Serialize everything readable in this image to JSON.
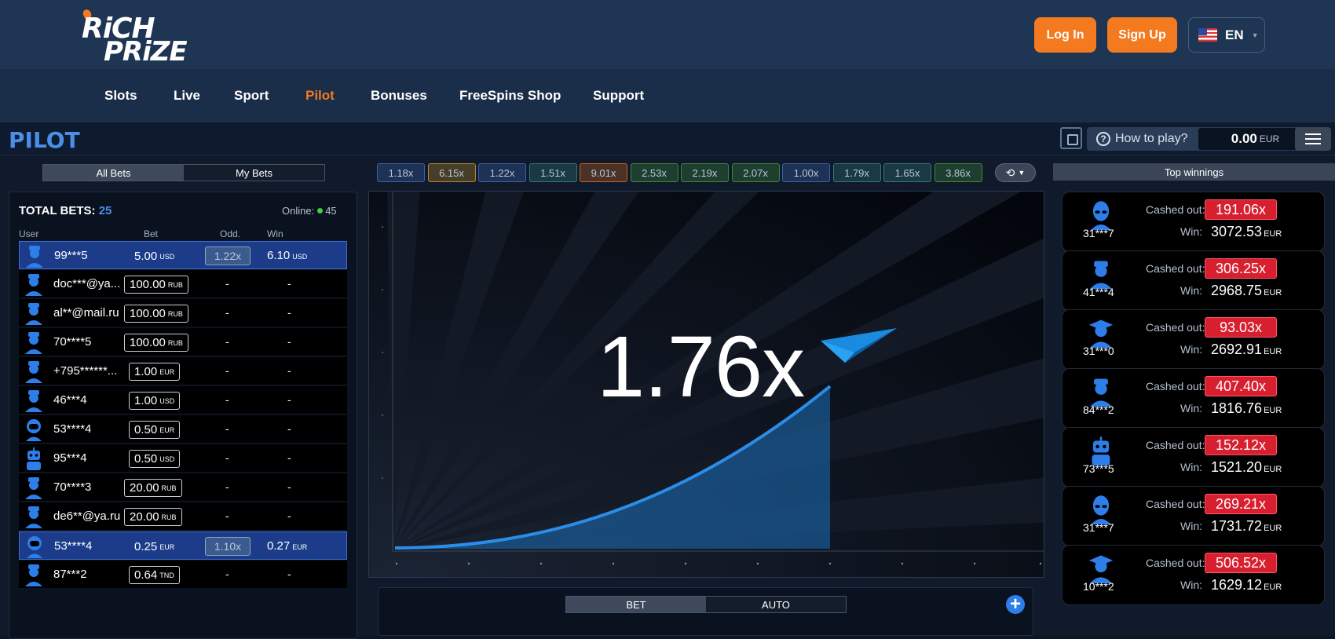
{
  "header": {
    "logo": {
      "line1": "RiCH",
      "line2": "PRiZE"
    },
    "login_label": "Log In",
    "signup_label": "Sign Up",
    "language": "EN",
    "colors": {
      "header_bg": "#1f3554",
      "accent": "#f47a1f",
      "active_nav": "#f47a1f"
    }
  },
  "nav": {
    "items": [
      {
        "label": "Slots",
        "active": false
      },
      {
        "label": "Live",
        "active": false
      },
      {
        "label": "Sport",
        "active": false
      },
      {
        "label": "Pilot",
        "active": true
      },
      {
        "label": "Bonuses",
        "active": false
      },
      {
        "label": "FreeSpins Shop",
        "active": false
      },
      {
        "label": "Support",
        "active": false
      }
    ]
  },
  "gamebar": {
    "title": "PILOT",
    "how_to_play": "How to play?",
    "balance_value": "0.00",
    "balance_currency": "EUR"
  },
  "bets": {
    "tabs": [
      {
        "label": "All Bets",
        "active": true
      },
      {
        "label": "My Bets",
        "active": false
      }
    ],
    "total_label": "TOTAL BETS",
    "total_value": "25",
    "online_label": "Online:",
    "online_value": "45",
    "columns": [
      "User",
      "Bet",
      "Odd.",
      "Win"
    ],
    "rows": [
      {
        "user": "99***5",
        "bet": "5.00",
        "currency": "USD",
        "odd": "1.22x",
        "win": "6.10",
        "win_currency": "USD",
        "won": true,
        "avatar": "user-icon"
      },
      {
        "user": "doc***@ya...",
        "bet": "100.00",
        "currency": "RUB",
        "odd": "-",
        "win": "-",
        "won": false,
        "avatar": "doctor-icon"
      },
      {
        "user": "al**@mail.ru",
        "bet": "100.00",
        "currency": "RUB",
        "odd": "-",
        "win": "-",
        "won": false,
        "avatar": "businessman-icon"
      },
      {
        "user": "70****5",
        "bet": "100.00",
        "currency": "RUB",
        "odd": "-",
        "win": "-",
        "won": false,
        "avatar": "builder-icon"
      },
      {
        "user": "+795******...",
        "bet": "1.00",
        "currency": "EUR",
        "odd": "-",
        "win": "-",
        "won": false,
        "avatar": "builder-icon"
      },
      {
        "user": "46***4",
        "bet": "1.00",
        "currency": "USD",
        "odd": "-",
        "win": "-",
        "won": false,
        "avatar": "cowboy-icon"
      },
      {
        "user": "53****4",
        "bet": "0.50",
        "currency": "EUR",
        "odd": "-",
        "win": "-",
        "won": false,
        "avatar": "astronaut-icon"
      },
      {
        "user": "95***4",
        "bet": "0.50",
        "currency": "USD",
        "odd": "-",
        "win": "-",
        "won": false,
        "avatar": "robot-icon"
      },
      {
        "user": "70****3",
        "bet": "20.00",
        "currency": "RUB",
        "odd": "-",
        "win": "-",
        "won": false,
        "avatar": "police-icon"
      },
      {
        "user": "de6**@ya.ru",
        "bet": "20.00",
        "currency": "RUB",
        "odd": "-",
        "win": "-",
        "won": false,
        "avatar": "user-icon"
      },
      {
        "user": "53****4",
        "bet": "0.25",
        "currency": "EUR",
        "odd": "1.10x",
        "win": "0.27",
        "win_currency": "EUR",
        "won": true,
        "avatar": "astronaut-icon"
      },
      {
        "user": "87***2",
        "bet": "0.64",
        "currency": "TND",
        "odd": "-",
        "win": "-",
        "won": false,
        "avatar": "cowboy-icon"
      }
    ]
  },
  "history": {
    "items": [
      {
        "value": "1.18x",
        "color": "#3a62a8"
      },
      {
        "value": "6.15x",
        "color": "#b8862a"
      },
      {
        "value": "1.22x",
        "color": "#3a62a8"
      },
      {
        "value": "1.51x",
        "color": "#2e7b78"
      },
      {
        "value": "9.01x",
        "color": "#c4621e"
      },
      {
        "value": "2.53x",
        "color": "#3d8a3d"
      },
      {
        "value": "2.19x",
        "color": "#3d8a3d"
      },
      {
        "value": "2.07x",
        "color": "#3d8a3d"
      },
      {
        "value": "1.00x",
        "color": "#3a62a8"
      },
      {
        "value": "1.79x",
        "color": "#2e7b78"
      },
      {
        "value": "1.65x",
        "color": "#2e7b78"
      },
      {
        "value": "3.86x",
        "color": "#3d8a3d"
      }
    ]
  },
  "game": {
    "multiplier": "1.76x",
    "bet_tabs": [
      {
        "label": "BET",
        "active": true
      },
      {
        "label": "AUTO",
        "active": false
      }
    ]
  },
  "top_winnings": {
    "title": "Top winnings",
    "cashed_label": "Cashed out:",
    "win_label": "Win:",
    "currency": "EUR",
    "items": [
      {
        "user": "31***7",
        "cashed": "191.06x",
        "win": "3072.53",
        "avatar": "alien-icon"
      },
      {
        "user": "41***4",
        "cashed": "306.25x",
        "win": "2968.75",
        "avatar": "doctor-icon"
      },
      {
        "user": "31***0",
        "cashed": "93.03x",
        "win": "2692.91",
        "avatar": "graduate-icon"
      },
      {
        "user": "84***2",
        "cashed": "407.40x",
        "win": "1816.76",
        "avatar": "police-icon"
      },
      {
        "user": "73***5",
        "cashed": "152.12x",
        "win": "1521.20",
        "avatar": "robot-icon"
      },
      {
        "user": "31***7",
        "cashed": "269.21x",
        "win": "1731.72",
        "avatar": "alien-icon"
      },
      {
        "user": "10***2",
        "cashed": "506.52x",
        "win": "1629.12",
        "avatar": "graduate-icon"
      }
    ]
  }
}
